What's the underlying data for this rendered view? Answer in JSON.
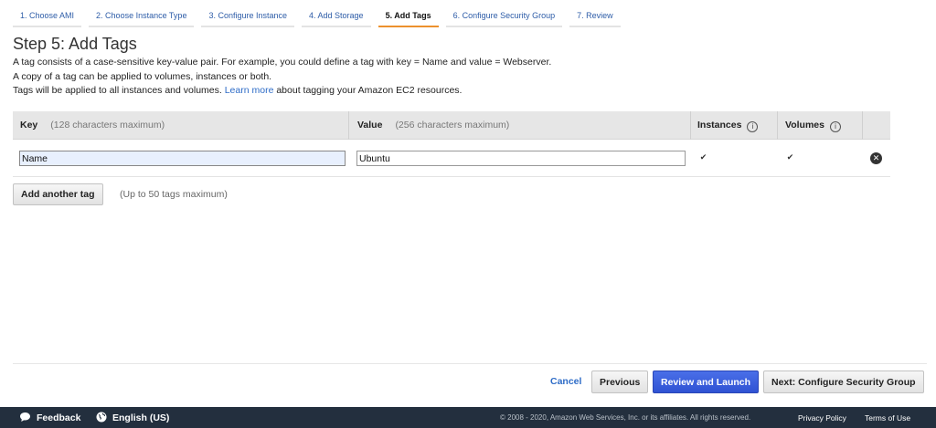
{
  "wizard": {
    "steps": [
      {
        "label": "1. Choose AMI"
      },
      {
        "label": "2. Choose Instance Type"
      },
      {
        "label": "3. Configure Instance"
      },
      {
        "label": "4. Add Storage"
      },
      {
        "label": "5. Add Tags",
        "active": true
      },
      {
        "label": "6. Configure Security Group"
      },
      {
        "label": "7. Review"
      }
    ]
  },
  "page": {
    "title": "Step 5: Add Tags",
    "desc_line1": "A tag consists of a case-sensitive key-value pair. For example, you could define a tag with key = Name and value = Webserver.",
    "desc_line2": "A copy of a tag can be applied to volumes, instances or both.",
    "desc_line3_pre": "Tags will be applied to all instances and volumes.",
    "desc_link": "Learn more",
    "desc_line3_post": "about tagging your Amazon EC2 resources."
  },
  "table": {
    "headers": {
      "key": "Key",
      "key_hint": "(128 characters maximum)",
      "value": "Value",
      "value_hint": "(256 characters maximum)",
      "instances": "Instances",
      "volumes": "Volumes"
    },
    "rows": [
      {
        "key": "Name",
        "value": "Ubuntu",
        "instances": true,
        "volumes": true
      }
    ]
  },
  "actions": {
    "add_tag": "Add another tag",
    "add_tag_note": "(Up to 50 tags maximum)",
    "cancel": "Cancel",
    "previous": "Previous",
    "review_launch": "Review and Launch",
    "next": "Next: Configure Security Group"
  },
  "footer": {
    "feedback": "Feedback",
    "language": "English (US)",
    "copyright": "© 2008 - 2020, Amazon Web Services, Inc. or its affiliates. All rights reserved.",
    "privacy": "Privacy Policy",
    "terms": "Terms of Use"
  },
  "colors": {
    "accent_orange": "#ec912d",
    "primary_blue": "#2f52d3",
    "footer_bg": "#232f3e"
  }
}
